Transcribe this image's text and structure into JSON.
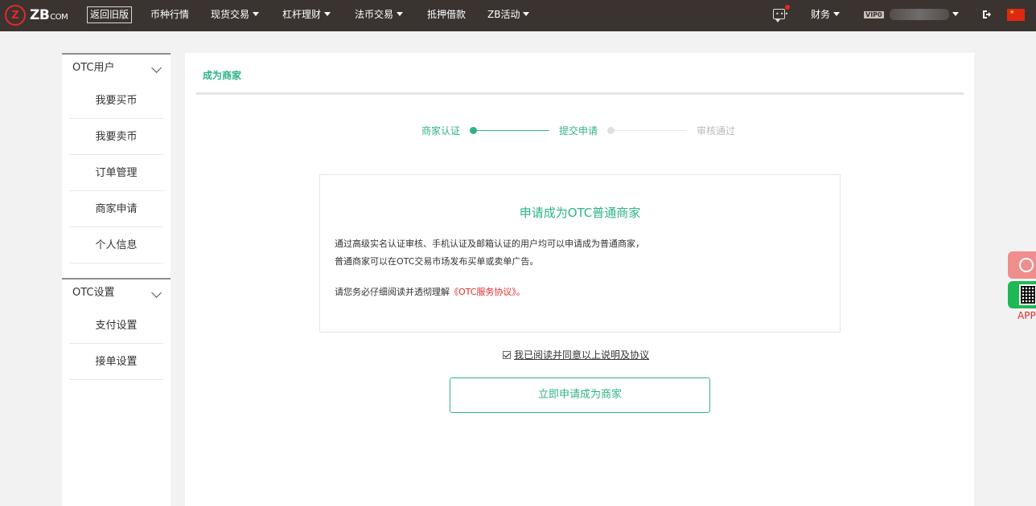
{
  "header": {
    "logo_mark": "Z",
    "logo_text": "ZB",
    "logo_suffix": "COM",
    "old_version_label": "返回旧版",
    "nav": [
      {
        "label": "币种行情",
        "dropdown": false
      },
      {
        "label": "现货交易",
        "dropdown": true
      },
      {
        "label": "杠杆理财",
        "dropdown": true
      },
      {
        "label": "法币交易",
        "dropdown": true
      },
      {
        "label": "抵押借款",
        "dropdown": false
      },
      {
        "label": "ZB活动",
        "dropdown": true
      }
    ],
    "finance_label": "财务",
    "vip_label": "VIP0",
    "language_flag": "CN",
    "message_icon": "message-icon",
    "logout_icon": "logout-icon"
  },
  "sidebar": {
    "groups": [
      {
        "title": "OTC用户",
        "items": [
          "我要买币",
          "我要卖币",
          "订单管理",
          "商家申请",
          "个人信息"
        ]
      },
      {
        "title": "OTC设置",
        "items": [
          "支付设置",
          "接单设置"
        ]
      }
    ]
  },
  "main": {
    "tab": "成为商家",
    "steps": [
      {
        "label": "商家认证",
        "status": "done"
      },
      {
        "label": "提交申请",
        "status": "current"
      },
      {
        "label": "审核通过",
        "status": "pending"
      }
    ],
    "card": {
      "title": "申请成为OTC普通商家",
      "line1": "通过高级实名认证审核、手机认证及邮箱认证的用户均可以申请成为普通商家，",
      "line2": "普通商家可以在OTC交易市场发布买单或卖单广告。",
      "line3_prefix": "请您务必仔细阅读并透彻理解",
      "line3_link": "《OTC服务协议》",
      "line3_suffix": "。"
    },
    "agree_label": "我已阅读并同意以上说明及协议",
    "agree_checked": true,
    "apply_button": "立即申请成为商家"
  },
  "floating": {
    "app_label": "APP"
  },
  "colors": {
    "accent": "#2fb28a",
    "brand_red": "#e02a2a",
    "topbar": "#3b3330"
  }
}
